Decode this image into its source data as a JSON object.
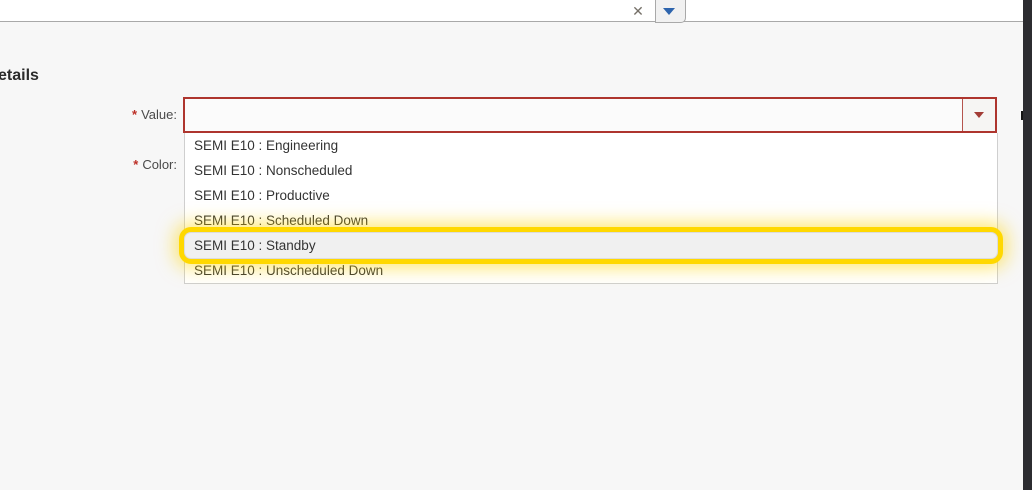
{
  "header": {
    "combobox": {
      "value": "",
      "clear_glyph": "✕",
      "arrow_icon": "chevron-down-icon",
      "arrow_color": "#2d64ad"
    }
  },
  "section": {
    "heading": "etails"
  },
  "form": {
    "required_marker": "*",
    "value_label": "Value:",
    "color_label": "Color:"
  },
  "dropdown": {
    "items": [
      "SEMI E10 : Engineering",
      "SEMI E10 : Nonscheduled",
      "SEMI E10 : Productive",
      "SEMI E10 : Scheduled Down",
      "SEMI E10 : Standby",
      "SEMI E10 : Unscheduled Down"
    ],
    "highlighted_index": 4
  },
  "colors": {
    "error_border": "#ae352e",
    "required_marker": "#bc2f26",
    "highlight_ring": "#ffd800",
    "highlight_row_bg": "#f0f0f0",
    "top_arrow": "#2d64ad",
    "dark_edge": "#2c2c30",
    "page_bg": "#f7f7f7"
  }
}
